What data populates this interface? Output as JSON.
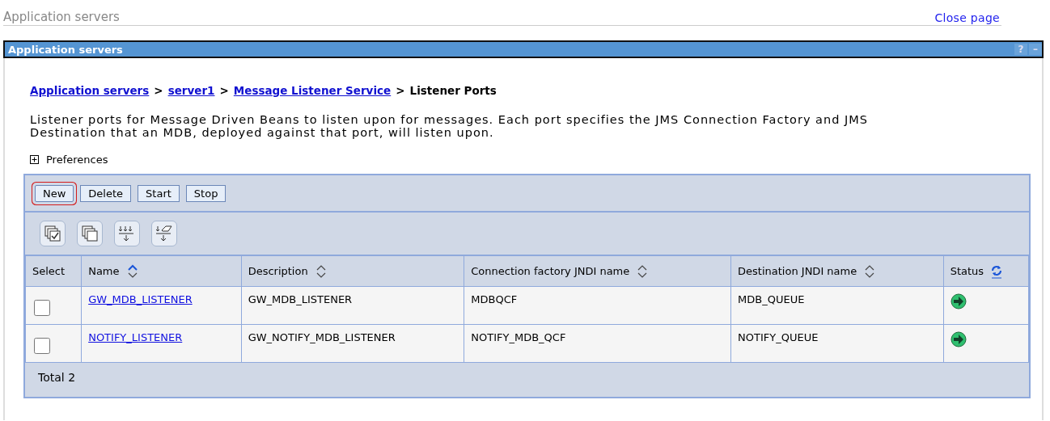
{
  "page_title": "Application servers",
  "close_link": "Close page",
  "panel": {
    "title": "Application servers",
    "help": "?",
    "minimize": "–"
  },
  "breadcrumb": [
    {
      "kind": "link",
      "label": "Application servers"
    },
    {
      "kind": "link",
      "label": "server1"
    },
    {
      "kind": "link",
      "label": "Message Listener Service"
    },
    {
      "kind": "current",
      "label": "Listener Ports"
    }
  ],
  "breadcrumb_separator": ">",
  "description": "Listener ports for Message Driven Beans to listen upon for messages. Each port specifies the JMS Connection Factory and JMS Destination that an MDB, deployed against that port, will listen upon.",
  "preferences": {
    "label": "Preferences",
    "expanded": false
  },
  "buttons": [
    {
      "label": "New",
      "circled": true
    },
    {
      "label": "Delete",
      "circled": false
    },
    {
      "label": "Start",
      "circled": false
    },
    {
      "label": "Stop",
      "circled": false
    }
  ],
  "tool_icons": [
    {
      "kind": "select-all"
    },
    {
      "kind": "deselect-all"
    },
    {
      "kind": "show-filter"
    },
    {
      "kind": "clear-filter"
    }
  ],
  "columns": [
    {
      "label": "Select",
      "kind": "plain"
    },
    {
      "label": "Name",
      "kind": "sortable",
      "sorted": true
    },
    {
      "label": "Description",
      "kind": "sortable",
      "sorted": false
    },
    {
      "label": "Connection factory JNDI name",
      "kind": "sortable",
      "sorted": false
    },
    {
      "label": "Destination JNDI name",
      "kind": "sortable",
      "sorted": false
    },
    {
      "label": "Status",
      "kind": "status"
    }
  ],
  "rows": [
    {
      "checked": false,
      "name": "GW_MDB_LISTENER",
      "description": "GW_MDB_LISTENER",
      "connection_factory": "MDBQCF",
      "destination": "MDB_QUEUE",
      "started": true
    },
    {
      "checked": false,
      "name": "NOTIFY_LISTENER",
      "description": "GW_NOTIFY_MDB_LISTENER",
      "connection_factory": "NOTIFY_MDB_QCF",
      "destination": "NOTIFY_QUEUE",
      "started": true
    }
  ],
  "total": "Total 2"
}
